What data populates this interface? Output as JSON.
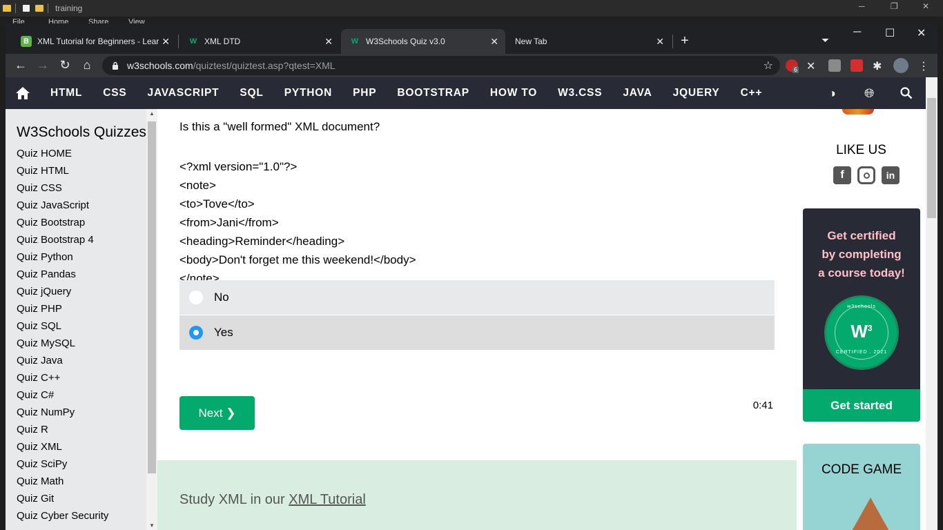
{
  "explorer": {
    "title": "training",
    "ribbon": [
      "File",
      "Home",
      "Share",
      "View"
    ]
  },
  "tabs": [
    {
      "label": "XML Tutorial for Beginners - Lear",
      "favicon_color": "#5fb24a",
      "favicon_glyph": "B"
    },
    {
      "label": "XML DTD",
      "favicon_color": "#04aa6d",
      "favicon_glyph": "W"
    },
    {
      "label": "W3Schools Quiz v3.0",
      "favicon_color": "#04aa6d",
      "favicon_glyph": "W"
    },
    {
      "label": "New Tab",
      "favicon_color": "",
      "favicon_glyph": ""
    }
  ],
  "omnibox": {
    "domain": "w3schools.com",
    "path": "/quiztest/quiztest.asp?qtest=XML"
  },
  "extensions": {
    "badge_count": "6"
  },
  "topnav": {
    "links": [
      "HTML",
      "CSS",
      "JAVASCRIPT",
      "SQL",
      "PYTHON",
      "PHP",
      "BOOTSTRAP",
      "HOW TO",
      "W3.CSS",
      "JAVA",
      "JQUERY",
      "C++"
    ]
  },
  "sidebar": {
    "title": "W3Schools Quizzes",
    "items": [
      "Quiz HOME",
      "Quiz HTML",
      "Quiz CSS",
      "Quiz JavaScript",
      "Quiz Bootstrap",
      "Quiz Bootstrap 4",
      "Quiz Python",
      "Quiz Pandas",
      "Quiz jQuery",
      "Quiz PHP",
      "Quiz SQL",
      "Quiz MySQL",
      "Quiz Java",
      "Quiz C++",
      "Quiz C#",
      "Quiz NumPy",
      "Quiz R",
      "Quiz XML",
      "Quiz SciPy",
      "Quiz Math",
      "Quiz Git",
      "Quiz Cyber Security"
    ]
  },
  "quiz": {
    "question": "Is this a \"well formed\" XML document?",
    "code_lines": [
      "<?xml version=\"1.0\"?>",
      "<note>",
      "<to>Tove</to>",
      "<from>Jani</from>",
      "<heading>Reminder</heading>",
      "<body>Don't forget me this weekend!</body>",
      "</note>"
    ],
    "options": [
      {
        "label": "No",
        "selected": false
      },
      {
        "label": "Yes",
        "selected": true
      }
    ],
    "next_label": "Next ❯",
    "timer": "0:41"
  },
  "study": {
    "prefix": "Study XML in our ",
    "link": "XML Tutorial"
  },
  "right": {
    "like_title": "LIKE US",
    "social": [
      "facebook-icon",
      "instagram-icon",
      "linkedin-icon"
    ],
    "cert_lines": [
      "Get certified",
      "by completing",
      "a course today!"
    ],
    "badge_top": "w3schools",
    "badge_bottom": "CERTIFIED . 2021",
    "get_started": "Get started",
    "game_title": "CODE GAME"
  },
  "colors": {
    "brand_green": "#04aa6d",
    "topnav_bg": "#282a35",
    "sidebar_bg": "#e7e9eb",
    "selected_radio": "#2196F3"
  }
}
